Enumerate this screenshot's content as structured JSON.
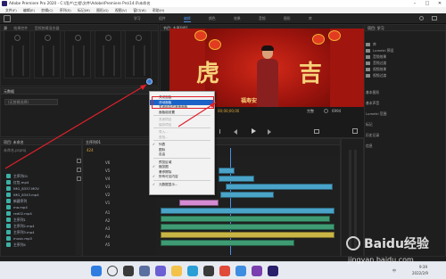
{
  "window": {
    "title": "Adobe Premiere Pro 2020 - C:\\用户\\工程\\文件\\Adobe\\Premiere Pro\\14.0\\未命名",
    "controls": [
      "–",
      "□",
      "✕"
    ]
  },
  "menubar": [
    "文件(F)",
    "编辑(E)",
    "剪辑(C)",
    "序列(S)",
    "标记(M)",
    "图形(G)",
    "视图(V)",
    "窗口(W)",
    "帮助(H)"
  ],
  "workspaces": [
    "学习",
    "组件",
    "编辑",
    "颜色",
    "效果",
    "音频",
    "图形",
    "库"
  ],
  "active_workspace": "编辑",
  "left_top": {
    "tabs": [
      "源",
      "效果控件",
      "音频剪辑混合器"
    ],
    "metadata_title": "元数据",
    "metadata_placeholder": "(无剪辑选择)"
  },
  "program_monitor": {
    "title": "节目: 主序列01",
    "timecode": "00;00;00;00",
    "zoom": "完整",
    "end_time": "6994",
    "poster": {
      "left_char": "虎",
      "right_char": "吉",
      "bottom_text": "福寿安康"
    }
  },
  "context_menu": {
    "items": [
      {
        "label": "关闭面板",
        "state": "normal"
      },
      {
        "label": "浮动面板",
        "state": "highlighted"
      },
      {
        "label": "关闭组中的其他面板",
        "state": "normal"
      },
      {
        "label": "面板组设置",
        "state": "normal"
      },
      {
        "sep": true
      },
      {
        "label": "关闭项目",
        "state": "disabled"
      },
      {
        "label": "保存项目",
        "state": "disabled"
      },
      {
        "sep": true
      },
      {
        "label": "导入...",
        "state": "disabled"
      },
      {
        "label": "查找...",
        "state": "disabled"
      },
      {
        "sep": true
      },
      {
        "label": "列表",
        "state": "checked"
      },
      {
        "label": "图标",
        "state": "normal"
      },
      {
        "label": "自由",
        "state": "normal"
      },
      {
        "sep": true
      },
      {
        "label": "预览区域",
        "state": "normal"
      },
      {
        "label": "缩览图",
        "state": "checked"
      },
      {
        "label": "悬停擦除",
        "state": "normal"
      },
      {
        "label": "所有可见内容",
        "state": "checked"
      },
      {
        "sep": true
      },
      {
        "label": "元数据显示...",
        "state": "checked"
      }
    ]
  },
  "project_panel": {
    "title": "项目: 未命名",
    "search_placeholder": "未命名.prproj",
    "items": [
      "主序列01",
      "红包.mp4",
      "IMG_8337.MOV",
      "IMG_8343.mp4",
      "新建序列",
      "ma.mp4",
      "red02.mp4",
      "主序列1",
      "主序列2.mp4",
      "主序列3.mp4",
      "music.mp3",
      "主序列4"
    ]
  },
  "timeline": {
    "title": "主序列01",
    "timecode": "424",
    "tracks": [
      "V6",
      "V5",
      "V4",
      "V3",
      "V2",
      "V1",
      "A1",
      "A2",
      "A3",
      "A4",
      "A5"
    ]
  },
  "right_panel": {
    "title": "项目: 学习",
    "items": [
      "库",
      "Lumetri 预设",
      "音频效果",
      "音频过渡",
      "视频效果",
      "视频过渡"
    ],
    "sections": [
      "基本图形",
      "基本声音",
      "Lumetri 范围",
      "标记",
      "历史记录",
      "信息"
    ]
  },
  "taskbar": {
    "time": "9:39",
    "date": "2022/2/9",
    "lang": "中"
  },
  "watermark": {
    "brand": "Baidu经验",
    "url": "jingyan.baidu.com"
  },
  "colors": {
    "accent": "#1a62c7",
    "annotation": "#e0202a",
    "workspace_active": "#4a90e2"
  }
}
